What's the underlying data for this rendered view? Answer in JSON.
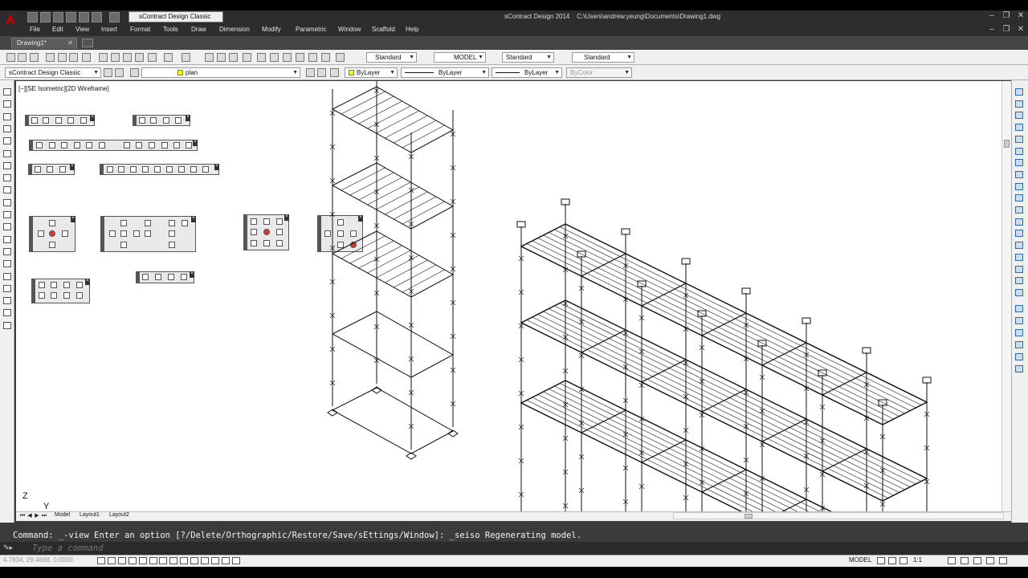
{
  "app": {
    "title_text": "sContract Design 2014    C:\\Users\\andrew.yeung\\Documents\\Drawing1.dwg",
    "workspace": "sContract Design Classic"
  },
  "menu": [
    "File",
    "Edit",
    "View",
    "Insert",
    "Format",
    "Tools",
    "Draw",
    "Dimension",
    "Modify",
    "Parametric",
    "Window",
    "Scaffold",
    "Help"
  ],
  "tabs": {
    "document": "Drawing1*"
  },
  "toolbar": {
    "text_style": "Standard",
    "layout_name": "MODEL",
    "table_style": "Standard",
    "multileader_style": "Standard",
    "workspace_combo": "sContract Design Classic",
    "layer": "plan",
    "color": "ByLayer",
    "linetype": "ByLayer",
    "lineweight": "ByLayer",
    "plotstyle": "ByColor"
  },
  "viewport": {
    "label": "[−][SE Isometric][2D Wireframe]",
    "ucs_z": "Z",
    "ucs_y": "Y"
  },
  "layout_tabs": [
    "Model",
    "Layout1",
    "Layout2"
  ],
  "command": {
    "history": "Command: _-view Enter an option [?/Delete/Orthographic/Restore/Save/sEttings/Window]: _seiso Regenerating model.",
    "placeholder": "Type a command"
  },
  "status": {
    "coords": "4.7834, 29.4688, 0.0000",
    "model": "MODEL",
    "scale": "1:1"
  },
  "colors": {
    "accent": "#c00000",
    "viewport_bg": "#ffffff",
    "chrome_dark": "#2d2d2d"
  }
}
